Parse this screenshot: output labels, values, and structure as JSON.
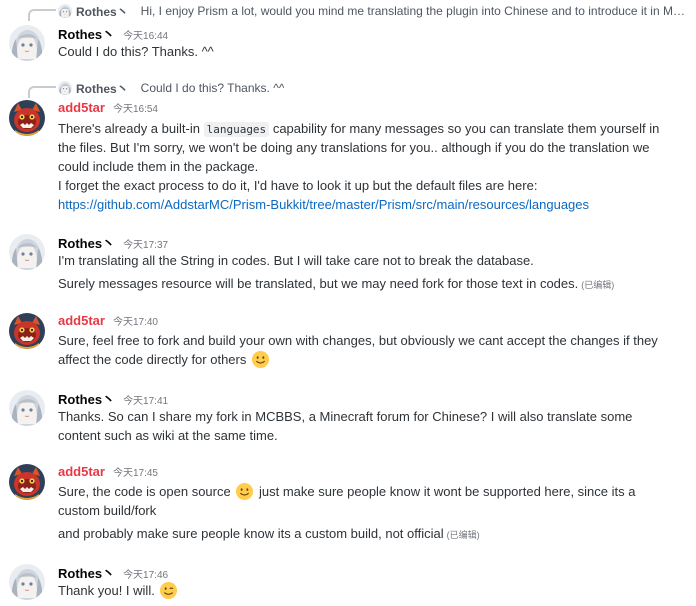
{
  "users": {
    "rothes": {
      "name": "Rothes丶",
      "avatar_icon": "anime-girl-avatar"
    },
    "add5tar": {
      "name": "add5tar",
      "avatar_icon": "red-mask-avatar",
      "name_color": "#e63946"
    }
  },
  "messages": [
    {
      "reply": {
        "author": "Rothes丶",
        "text": "Hi, I enjoy Prism a lot, would you mind me translating the plugin into Chinese and to introduce it in MCB..."
      },
      "author": "Rothes丶",
      "time": "今天16:44",
      "lines": [
        "Could I do this? Thanks. ^^"
      ]
    },
    {
      "reply": {
        "author": "Rothes丶",
        "text": "Could I do this? Thanks. ^^"
      },
      "author": "add5tar",
      "time": "今天16:54",
      "line1_pre": "There's already a built-in",
      "line1_code": "languages",
      "line1_post": "capability for many messages so you can translate them yourself in",
      "line2": "the files. But I'm sorry, we won't be doing any translations for you.. although if you do the translation we",
      "line3": "could include them in the package.",
      "line4": "I forget the exact process to do it, I'd have to look it up but the default files are here:",
      "link": "https://github.com/AddstarMC/Prism-Bukkit/tree/master/Prism/src/main/resources/languages"
    },
    {
      "author": "Rothes丶",
      "time": "今天17:37",
      "line1": "I'm translating all the String in codes. But I will take care not to break the database.",
      "line2": "Surely messages resource will be translated, but we may need fork for those text in codes.",
      "edited": "(已编辑)"
    },
    {
      "author": "add5tar",
      "time": "今天17:40",
      "line1": "Sure, feel free to fork and build your own with changes, but obviously we cant accept the changes if they",
      "line2": "affect the code directly for others",
      "emoji": "slightly-smiling-face-emoji"
    },
    {
      "author": "Rothes丶",
      "time": "今天17:41",
      "line1": "Thanks. So can I share my fork in MCBBS, a Minecraft forum for Chinese? I will also translate some",
      "line2": "content such as wiki at the same time."
    },
    {
      "author": "add5tar",
      "time": "今天17:45",
      "line1_pre": "Sure, the code is open source",
      "line1_post": "just make sure people know it wont be supported here, since its a",
      "line2": "custom build/fork",
      "line3": "and probably make sure people know its a custom build, not official",
      "edited": "(已编辑)",
      "emoji": "slightly-smiling-face-emoji"
    },
    {
      "author": "Rothes丶",
      "time": "今天17:46",
      "line1": "Thank you! I will.",
      "emoji": "winking-face-emoji"
    }
  ]
}
